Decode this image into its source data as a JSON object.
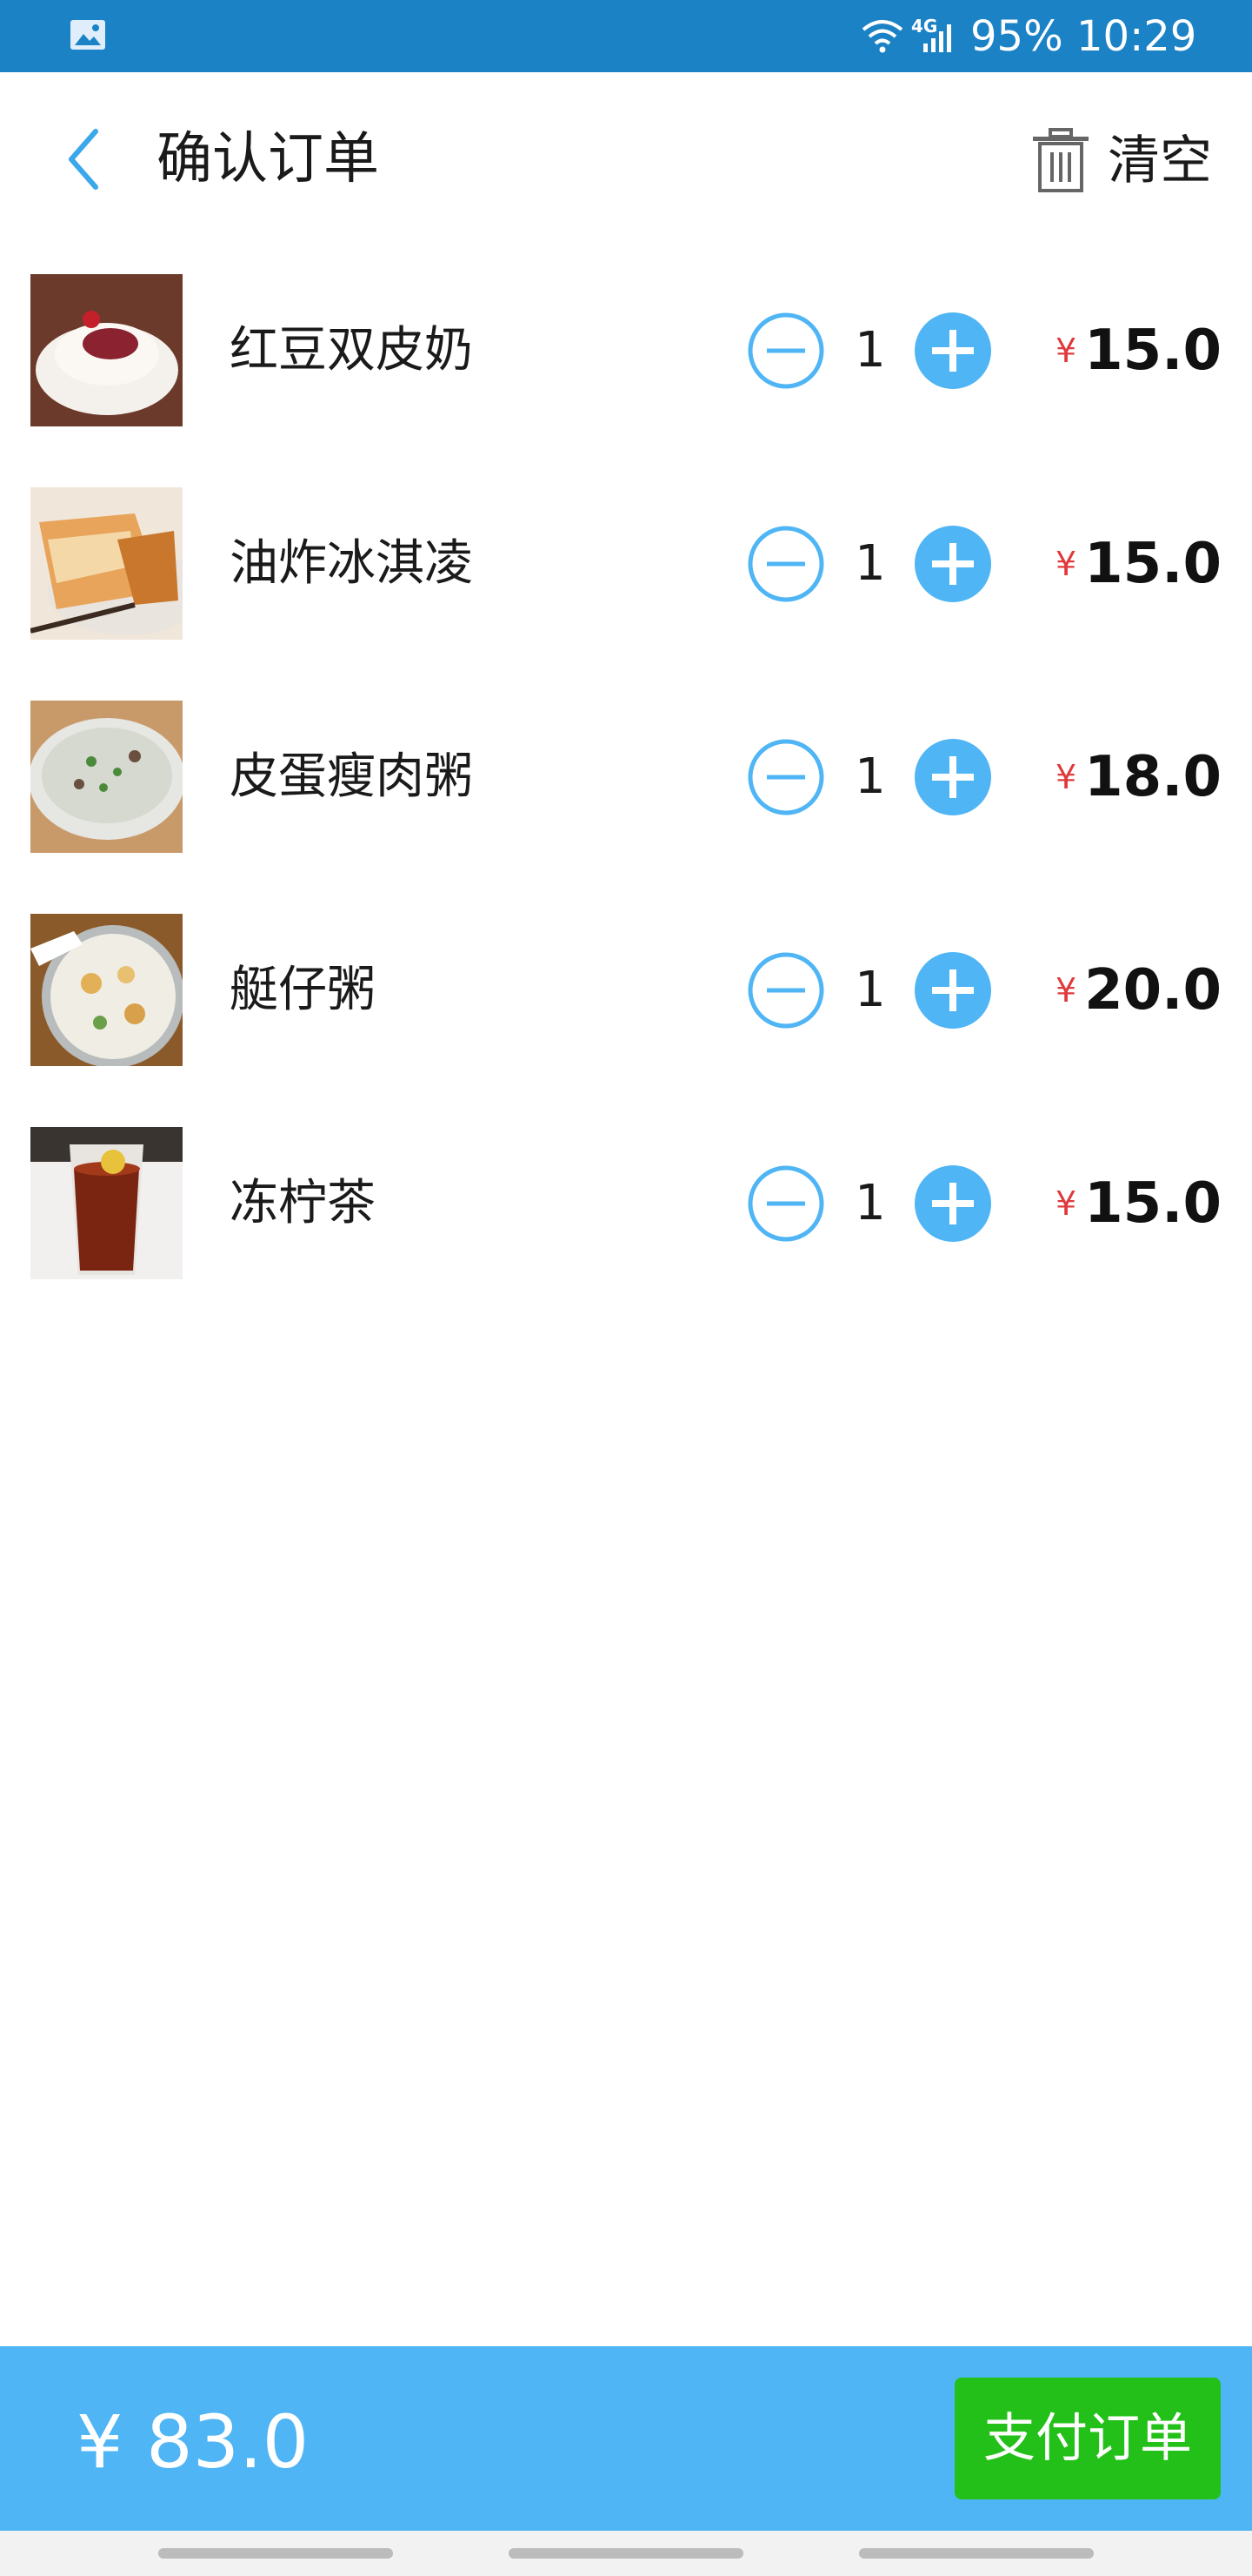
{
  "status_bar": {
    "network": "4G",
    "battery": "95%",
    "time": "10:29",
    "icons": [
      "gallery-icon",
      "wifi-icon",
      "signal-icon"
    ]
  },
  "header": {
    "title": "确认订单",
    "clear_label": "清空",
    "icons": [
      "back-icon",
      "trash-icon"
    ]
  },
  "currency_symbol": "¥",
  "items": [
    {
      "name": "红豆双皮奶",
      "qty": "1",
      "price": "15.0",
      "image": "red-bean-double-skin-milk"
    },
    {
      "name": "油炸冰淇凌",
      "qty": "1",
      "price": "15.0",
      "image": "fried-ice-cream"
    },
    {
      "name": "皮蛋瘦肉粥",
      "qty": "1",
      "price": "18.0",
      "image": "century-egg-pork-congee"
    },
    {
      "name": "艇仔粥",
      "qty": "1",
      "price": "20.0",
      "image": "sampan-congee"
    },
    {
      "name": "冻柠茶",
      "qty": "1",
      "price": "15.0",
      "image": "iced-lemon-tea"
    }
  ],
  "footer": {
    "total": "¥ 83.0",
    "pay_label": "支付订单"
  },
  "colors": {
    "status_bar": "#1b82c6",
    "accent": "#4fb5f5",
    "pay_button": "#23c019",
    "currency": "#e0393c"
  }
}
